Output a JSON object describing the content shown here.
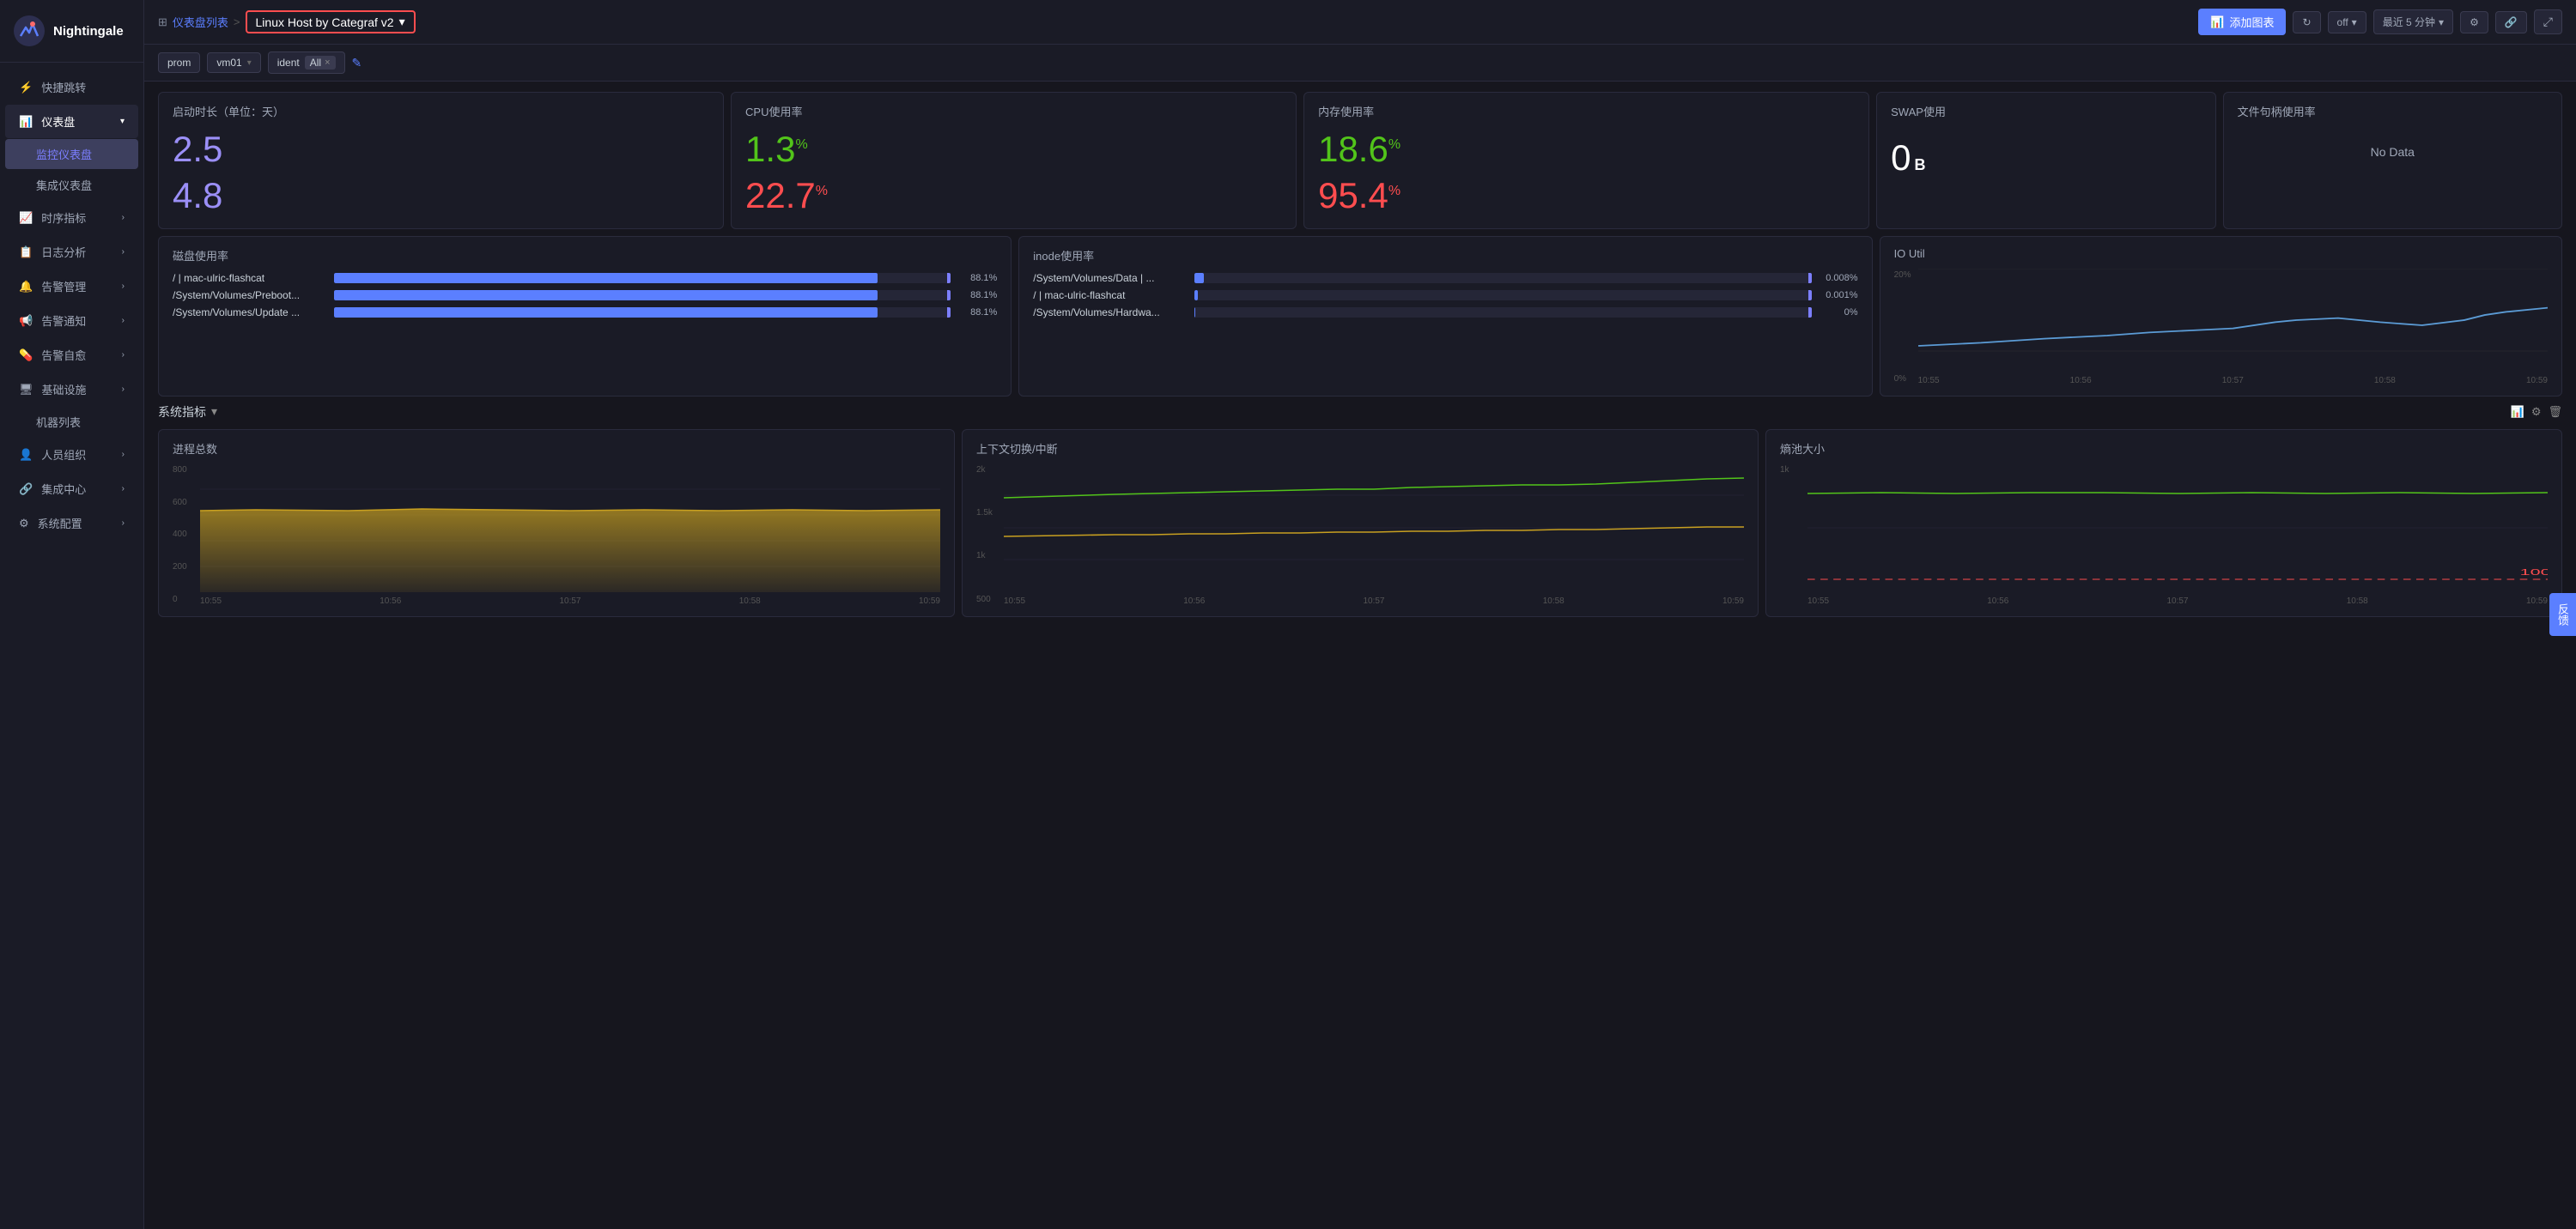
{
  "app": {
    "name": "Nightingale"
  },
  "sidebar": {
    "items": [
      {
        "id": "quick-jump",
        "label": "快捷跳转",
        "icon": "⚡",
        "hasChevron": false
      },
      {
        "id": "dashboard",
        "label": "仪表盘",
        "icon": "📊",
        "hasChevron": true,
        "expanded": true
      },
      {
        "id": "monitor-dashboard",
        "label": "监控仪表盘",
        "sub": true,
        "active": true
      },
      {
        "id": "integrated-dashboard",
        "label": "集成仪表盘",
        "sub": true
      },
      {
        "id": "metrics",
        "label": "时序指标",
        "icon": "📈",
        "hasChevron": true
      },
      {
        "id": "log-analysis",
        "label": "日志分析",
        "icon": "📋",
        "hasChevron": true
      },
      {
        "id": "alert-mgmt",
        "label": "告警管理",
        "icon": "🔔",
        "hasChevron": true
      },
      {
        "id": "alert-notify",
        "label": "告警通知",
        "icon": "📢",
        "hasChevron": true
      },
      {
        "id": "alert-self-heal",
        "label": "告警自愈",
        "icon": "💊",
        "hasChevron": true
      },
      {
        "id": "infrastructure",
        "label": "基础设施",
        "icon": "🖥",
        "hasChevron": true
      },
      {
        "id": "machine-list",
        "label": "机器列表",
        "sub": true
      },
      {
        "id": "personnel",
        "label": "人员组织",
        "icon": "👤",
        "hasChevron": true
      },
      {
        "id": "integration",
        "label": "集成中心",
        "icon": "🔗",
        "hasChevron": true
      },
      {
        "id": "sys-config",
        "label": "系统配置",
        "icon": "⚙",
        "hasChevron": true
      }
    ]
  },
  "topbar": {
    "breadcrumb_link": "仪表盘列表",
    "breadcrumb_sep": ">",
    "dashboard_title": "Linux Host by Categraf v2",
    "add_chart_label": "添加图表",
    "refresh_label": "off",
    "time_range": "最近 5 分钟",
    "icon_refresh": "↻",
    "icon_settings": "⚙",
    "icon_share": "🔗",
    "icon_expand": "⤢"
  },
  "filterbar": {
    "datasource": "prom",
    "host": "vm01",
    "ident_label": "ident",
    "ident_value": "All",
    "edit_icon": "✎"
  },
  "metrics": {
    "uptime": {
      "title": "启动时长（单位：天）",
      "value1": "2.5",
      "value2": "4.8",
      "color1": "purple",
      "color2": "purple"
    },
    "cpu": {
      "title": "CPU使用率",
      "value1": "1.3",
      "unit1": "%",
      "value2": "22.7",
      "unit2": "%",
      "color1": "green",
      "color2": "red"
    },
    "memory": {
      "title": "内存使用率",
      "value1": "18.6",
      "unit1": "%",
      "value2": "95.4",
      "unit2": "%",
      "color1": "green",
      "color2": "red"
    },
    "swap": {
      "title": "SWAP使用",
      "value": "0",
      "unit": "B"
    },
    "filehandle": {
      "title": "文件句柄使用率",
      "nodata": "No Data"
    }
  },
  "disk": {
    "title": "磁盘使用率",
    "rows": [
      {
        "label": "/ | mac-ulric-flashcat",
        "value": 88.1,
        "text": "88.1%"
      },
      {
        "label": "/System/Volumes/Preboot...",
        "value": 88.1,
        "text": "88.1%"
      },
      {
        "label": "/System/Volumes/Update ...",
        "value": 88.1,
        "text": "88.1%"
      }
    ]
  },
  "inode": {
    "title": "inode使用率",
    "rows": [
      {
        "label": "/System/Volumes/Data | ...",
        "value": 0.008,
        "text": "0.008%"
      },
      {
        "label": "/ | mac-ulric-flashcat",
        "value": 0.001,
        "text": "0.001%"
      },
      {
        "label": "/System/Volumes/Hardwa...",
        "value": 0,
        "text": "0%"
      }
    ]
  },
  "io_util": {
    "title": "IO Util",
    "y_labels": [
      "20%",
      "0%"
    ],
    "x_labels": [
      "10:55",
      "10:56",
      "10:57",
      "10:58",
      "10:59"
    ]
  },
  "system_metrics": {
    "section_title": "系统指标",
    "process_total": {
      "title": "进程总数",
      "y_labels": [
        "800",
        "600",
        "400",
        "200",
        "0"
      ],
      "x_labels": [
        "10:55",
        "10:56",
        "10:57",
        "10:58",
        "10:59"
      ]
    },
    "context_switch": {
      "title": "上下文切换/中断",
      "y_labels": [
        "2k",
        "1.5k",
        "1k",
        "500"
      ],
      "x_labels": [
        "10:55",
        "10:56",
        "10:57",
        "10:58",
        "10:59"
      ]
    },
    "entropy": {
      "title": "熵池大小",
      "y_labels": [
        "1k",
        ""
      ],
      "x_labels": [
        "10:55",
        "10:56",
        "10:57",
        "10:58",
        "10:59"
      ]
    }
  },
  "feedback": {
    "label": "反馈"
  }
}
